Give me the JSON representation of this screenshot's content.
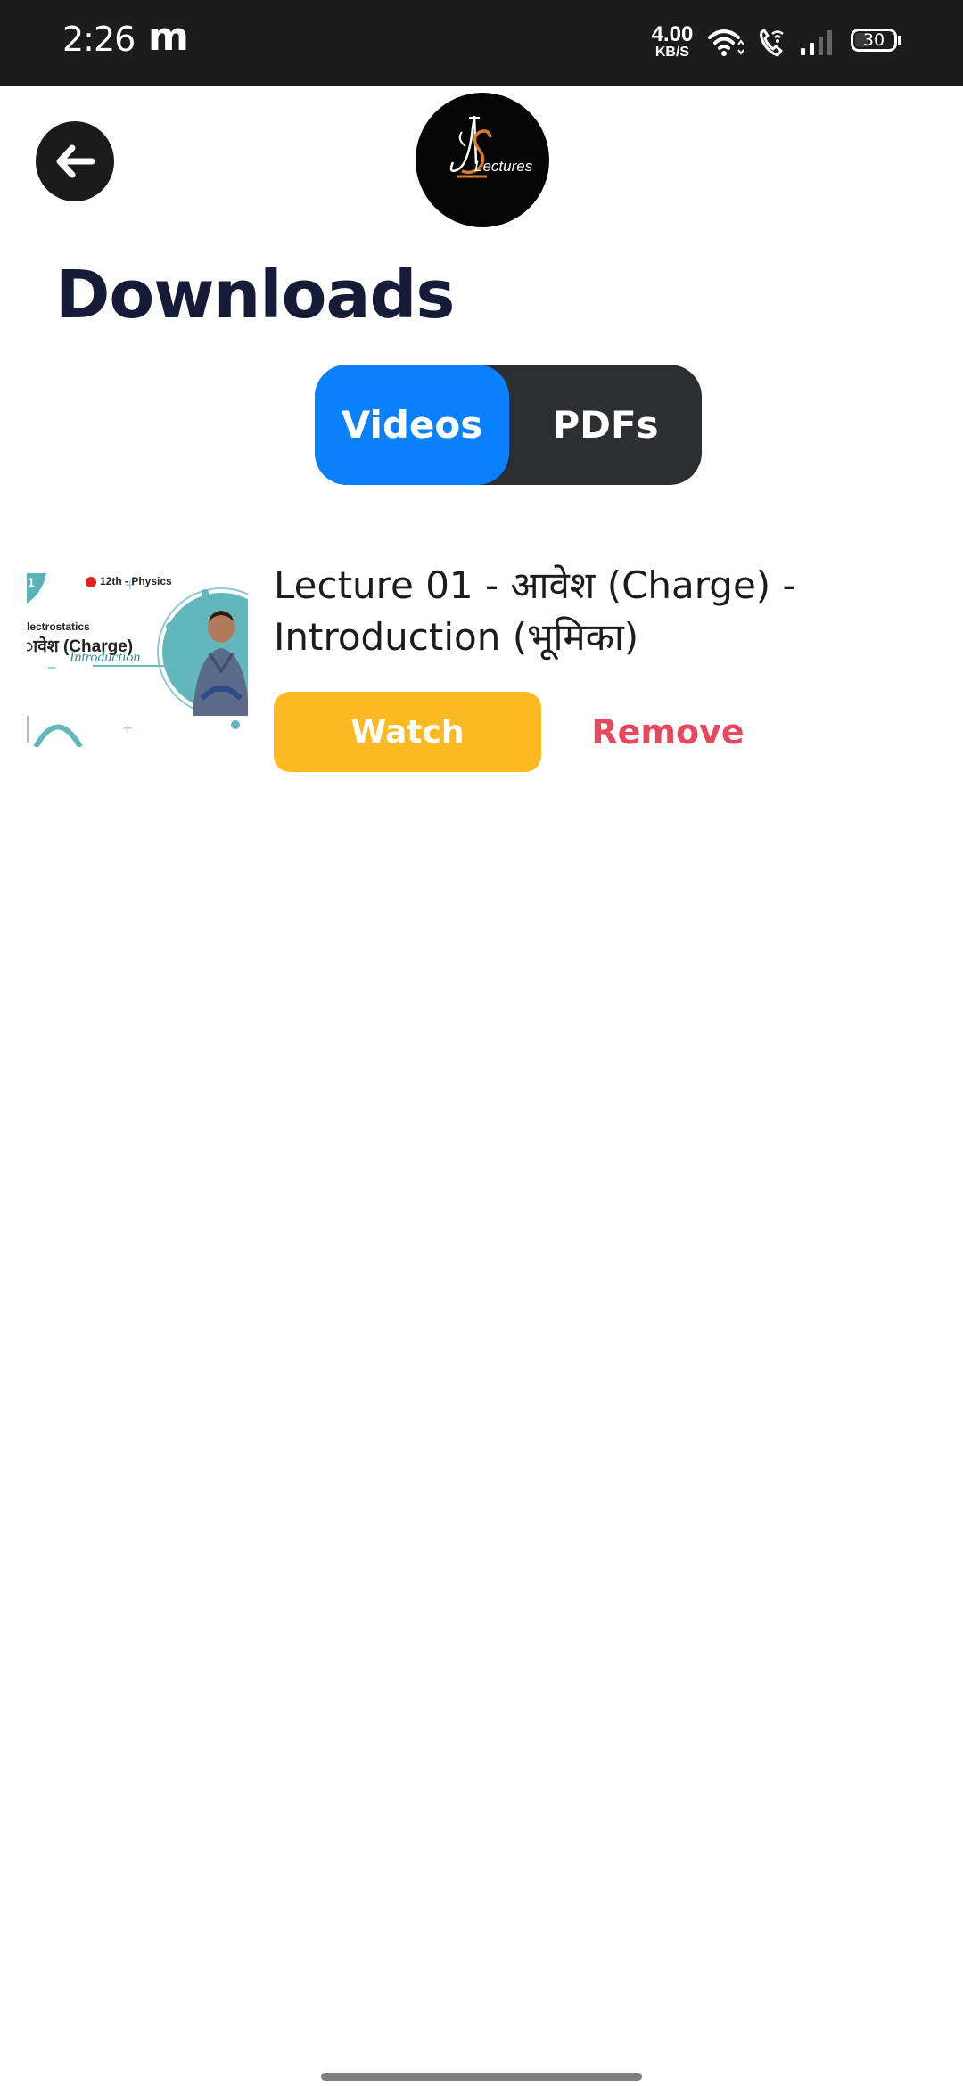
{
  "status_bar": {
    "time": "2:26",
    "notification_icon": "m",
    "net_speed_value": "4.00",
    "net_speed_unit": "KB/S",
    "icons": [
      "wifi-icon",
      "wifi-calling-icon",
      "signal-icon",
      "battery-icon"
    ],
    "battery_level": "30"
  },
  "header": {
    "back_icon": "arrow-left-icon",
    "logo_text": "Lectures",
    "logo_monogram": "AS"
  },
  "page": {
    "title": "Downloads"
  },
  "tabs": {
    "items": [
      {
        "label": "Videos",
        "active": true
      },
      {
        "label": "PDFs",
        "active": false
      }
    ]
  },
  "downloads": [
    {
      "title": "Lecture 01 - आवेश (Charge) - Introduction (भूमिका)",
      "thumbnail": {
        "badge": "12th - Physics",
        "chapter": "lectrostatics",
        "heading": "ावेश (Charge)",
        "subheading": "Introduction",
        "number": "1"
      },
      "watch_label": "Watch",
      "remove_label": "Remove"
    }
  ],
  "colors": {
    "accent_blue": "#0a80ff",
    "tab_dark": "#2c2e31",
    "watch_yellow": "#fbba22",
    "remove_red": "#e8485e",
    "title_navy": "#161c38",
    "logo_orange": "#d97a25"
  }
}
